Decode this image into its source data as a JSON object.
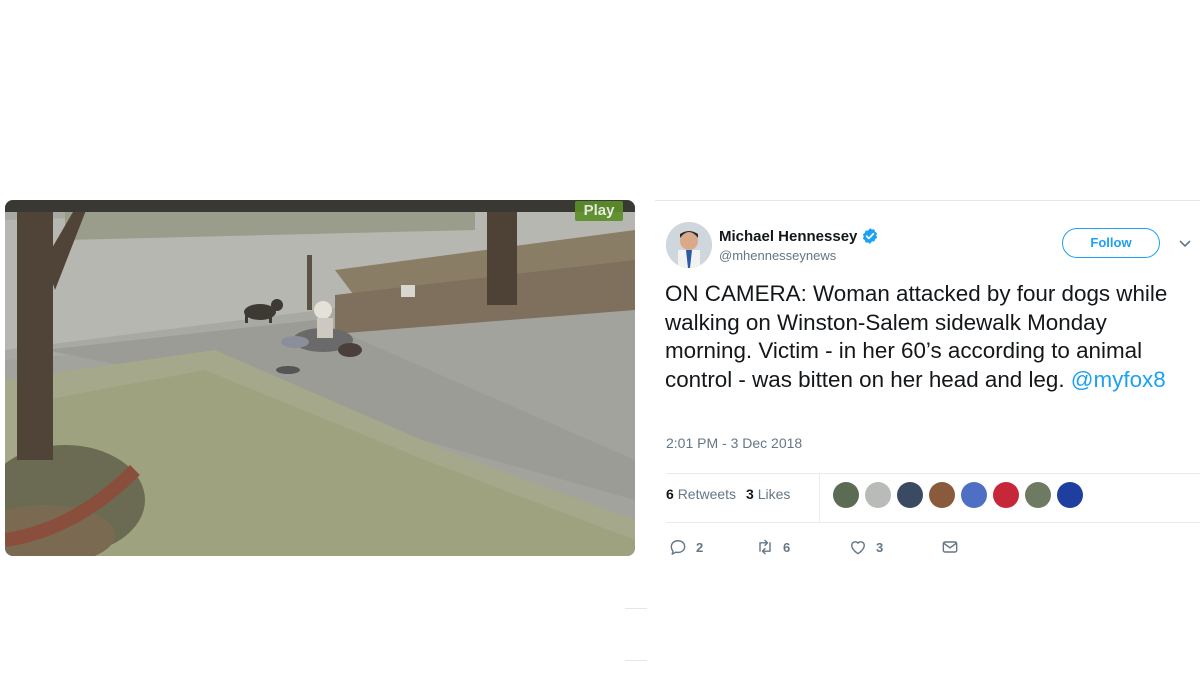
{
  "video": {
    "badge_label": "Play"
  },
  "tweet": {
    "display_name": "Michael Hennessey",
    "handle": "@mhennesseynews",
    "follow_label": "Follow",
    "text_body": "ON CAMERA: Woman attacked by four dogs while walking on Winston-Salem sidewalk Monday morning. Victim - in her 60’s according to animal control - was bitten on her head and leg. ",
    "mention": "@myfox8",
    "timestamp": "2:01 PM - 3 Dec 2018",
    "retweets_count": "6",
    "retweets_label": "Retweets",
    "likes_count": "3",
    "likes_label": "Likes",
    "liker_avatars": [
      {
        "name": "liker-avatar",
        "color": "#5b6b54"
      },
      {
        "name": "liker-avatar",
        "color": "#b9bbb8"
      },
      {
        "name": "liker-avatar",
        "color": "#3b4a63"
      },
      {
        "name": "liker-avatar",
        "color": "#8a5a3c"
      },
      {
        "name": "liker-avatar",
        "color": "#4f6fc4"
      },
      {
        "name": "liker-avatar",
        "color": "#c6283a"
      },
      {
        "name": "liker-avatar",
        "color": "#6f7a62"
      },
      {
        "name": "fox8-logo-avatar",
        "color": "#1f3fa0"
      }
    ],
    "actions": {
      "reply_count": "2",
      "retweet_count": "6",
      "like_count": "3"
    },
    "icons": [
      "verified-icon",
      "chevron-down-icon",
      "reply-icon",
      "retweet-icon",
      "heart-icon",
      "direct-message-icon"
    ],
    "colors": {
      "accent": "#1da1f2",
      "muted": "#657786",
      "text": "#14171a"
    }
  }
}
